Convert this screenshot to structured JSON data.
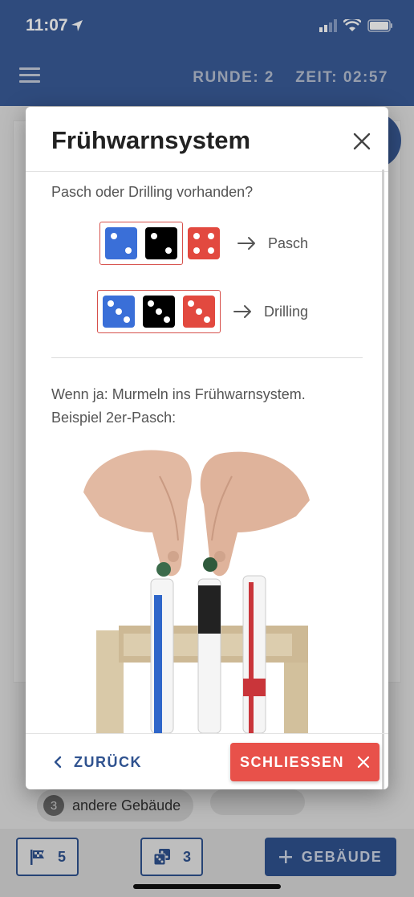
{
  "status_bar": {
    "time": "11:07"
  },
  "header": {
    "round": "RUNDE: 2",
    "time": "ZEIT: 02:57"
  },
  "dialog": {
    "title": "Frühwarnsystem",
    "question": "Pasch oder Drilling vorhanden?",
    "pasch_label": "Pasch",
    "drilling_label": "Drilling",
    "text_line1": "Wenn ja: Murmeln ins Frühwarnsystem.",
    "text_line2": "Beispiel 2er-Pasch:",
    "back_label": "ZURÜCK",
    "close_label": "SCHLIESSEN"
  },
  "background": {
    "chip_count": "3",
    "chip_label": "andere Gebäude",
    "flag_count": "5",
    "dice_count": "3",
    "gebaeude_label": "GEBÄUDE"
  },
  "colors": {
    "primary": "#2f528f",
    "header": "#3a5c99",
    "danger": "#e8514a",
    "die_blue": "#3a6fd8",
    "die_black": "#000000",
    "die_red": "#e2493f"
  },
  "icons": [
    "location-arrow-icon",
    "signal-icon",
    "wifi-icon",
    "battery-icon",
    "menu-icon",
    "close-icon",
    "arrow-right-icon",
    "chevron-left-icon",
    "flag-icon",
    "dice-icon",
    "plus-icon"
  ]
}
